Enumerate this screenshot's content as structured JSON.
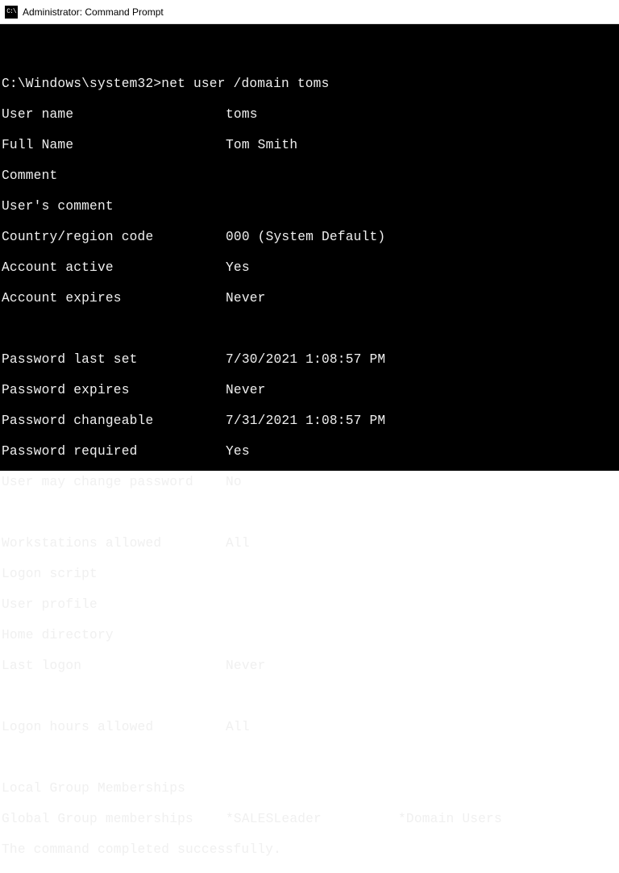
{
  "window": {
    "title": "Administrator: Command Prompt"
  },
  "prompt": {
    "path": "C:\\Windows\\system32>",
    "command": "net user /domain toms"
  },
  "fields": {
    "user_name": {
      "label": "User name",
      "value": "toms"
    },
    "full_name": {
      "label": "Full Name",
      "value": "Tom Smith"
    },
    "comment": {
      "label": "Comment",
      "value": ""
    },
    "users_comment": {
      "label": "User's comment",
      "value": ""
    },
    "country_region": {
      "label": "Country/region code",
      "value": "000 (System Default)"
    },
    "account_active": {
      "label": "Account active",
      "value": "Yes"
    },
    "account_expires": {
      "label": "Account expires",
      "value": "Never"
    },
    "pw_last_set": {
      "label": "Password last set",
      "value": "7/30/2021 1:08:57 PM"
    },
    "pw_expires": {
      "label": "Password expires",
      "value": "Never"
    },
    "pw_changeable": {
      "label": "Password changeable",
      "value": "7/31/2021 1:08:57 PM"
    },
    "pw_required": {
      "label": "Password required",
      "value": "Yes"
    },
    "user_may_change_pw": {
      "label": "User may change password",
      "value": "No"
    },
    "workstations": {
      "label": "Workstations allowed",
      "value": "All"
    },
    "logon_script": {
      "label": "Logon script",
      "value": ""
    },
    "user_profile": {
      "label": "User profile",
      "value": ""
    },
    "home_dir": {
      "label": "Home directory",
      "value": ""
    },
    "last_logon": {
      "label": "Last logon",
      "value": "Never"
    },
    "logon_hours": {
      "label": "Logon hours allowed",
      "value": "All"
    },
    "local_groups": {
      "label": "Local Group Memberships",
      "value": ""
    },
    "global_groups": {
      "label": "Global Group memberships",
      "g1": "*SALESLeader",
      "g2": "*Domain Users"
    }
  },
  "completion": "The command completed successfully."
}
